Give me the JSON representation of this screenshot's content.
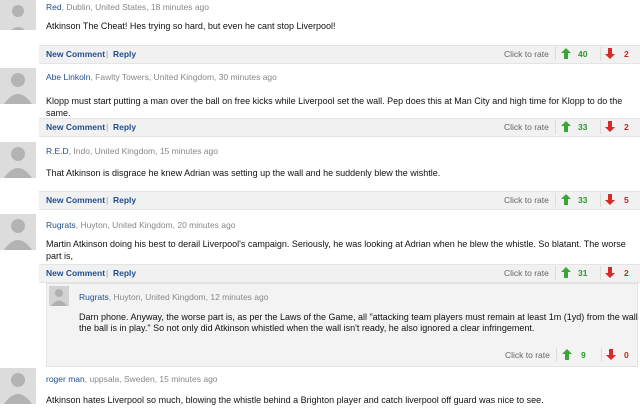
{
  "actions": {
    "new_comment": "New Comment",
    "reply": "Reply",
    "separator": "|",
    "rate": "Click to rate"
  },
  "comments": [
    {
      "name": "Red",
      "location": ", Dublin, United States, 18 minutes ago",
      "text": "Atkinson The Cheat! Hes trying so hard, but even he cant stop Liverpool!",
      "up": "40",
      "down": "2"
    },
    {
      "name": "Abe Linkoln",
      "location": ", Fawlty Towers, United Kingdom, 30 minutes ago",
      "text": "Klopp must start putting a man over the ball on free kicks while Liverpool set the wall. Pep does this at Man City and high time for Klopp to do the same.",
      "up": "33",
      "down": "2"
    },
    {
      "name": "R.E.D",
      "location": ", Indo, United Kingdom, 15 minutes ago",
      "text": "That Atkinson is disgrace he knew Adrian was setting up the wall and he suddenly blew the wishtle.",
      "up": "33",
      "down": "5"
    },
    {
      "name": "Rugrats",
      "location": ", Huyton, United Kingdom, 20 minutes ago",
      "text": "Martin Atkinson doing his best to derail Liverpool's campaign. Seriously, he was looking at Adrian when he blew the whistle. So blatant. The worse part is,",
      "up": "31",
      "down": "2"
    },
    {
      "name": "Rugrats",
      "location": ", Huyton, United Kingdom, 12 minutes ago",
      "text1": "Darn phone. Anyway, the worse part is, as per the Laws of the Game, all \"attacking team players must remain at least 1m (1yd) from the wall until",
      "text2": "the ball is in play.\" So not only did Atkinson whistled when the wall isn't ready, he also ignored a clear infringement.",
      "up": "9",
      "down": "0"
    },
    {
      "name": "roger man",
      "location": ", uppsala, Sweden, 15 minutes ago",
      "text": "Atkinson hates Liverpool so much, blowing the whistle behind a Brighton player and catch liverpool off guard was nice to see."
    }
  ]
}
